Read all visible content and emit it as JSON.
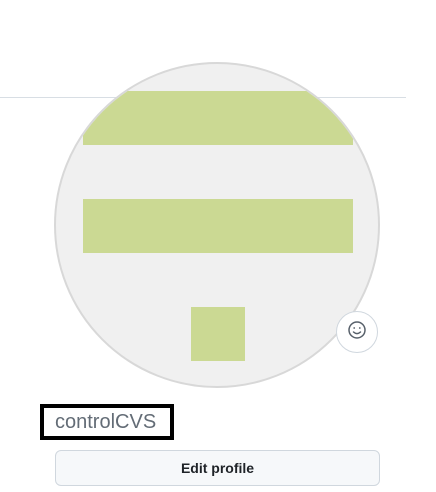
{
  "profile": {
    "username": "controlCVS",
    "edit_button_label": "Edit profile"
  },
  "avatar": {
    "type": "identicon",
    "background_color": "#f0f0f0",
    "foreground_color": "#cbd993"
  },
  "status": {
    "icon": "smiley-icon"
  },
  "colors": {
    "accent_green": "#cbd993",
    "username_text": "#636c76",
    "button_bg": "#f6f8fa"
  }
}
